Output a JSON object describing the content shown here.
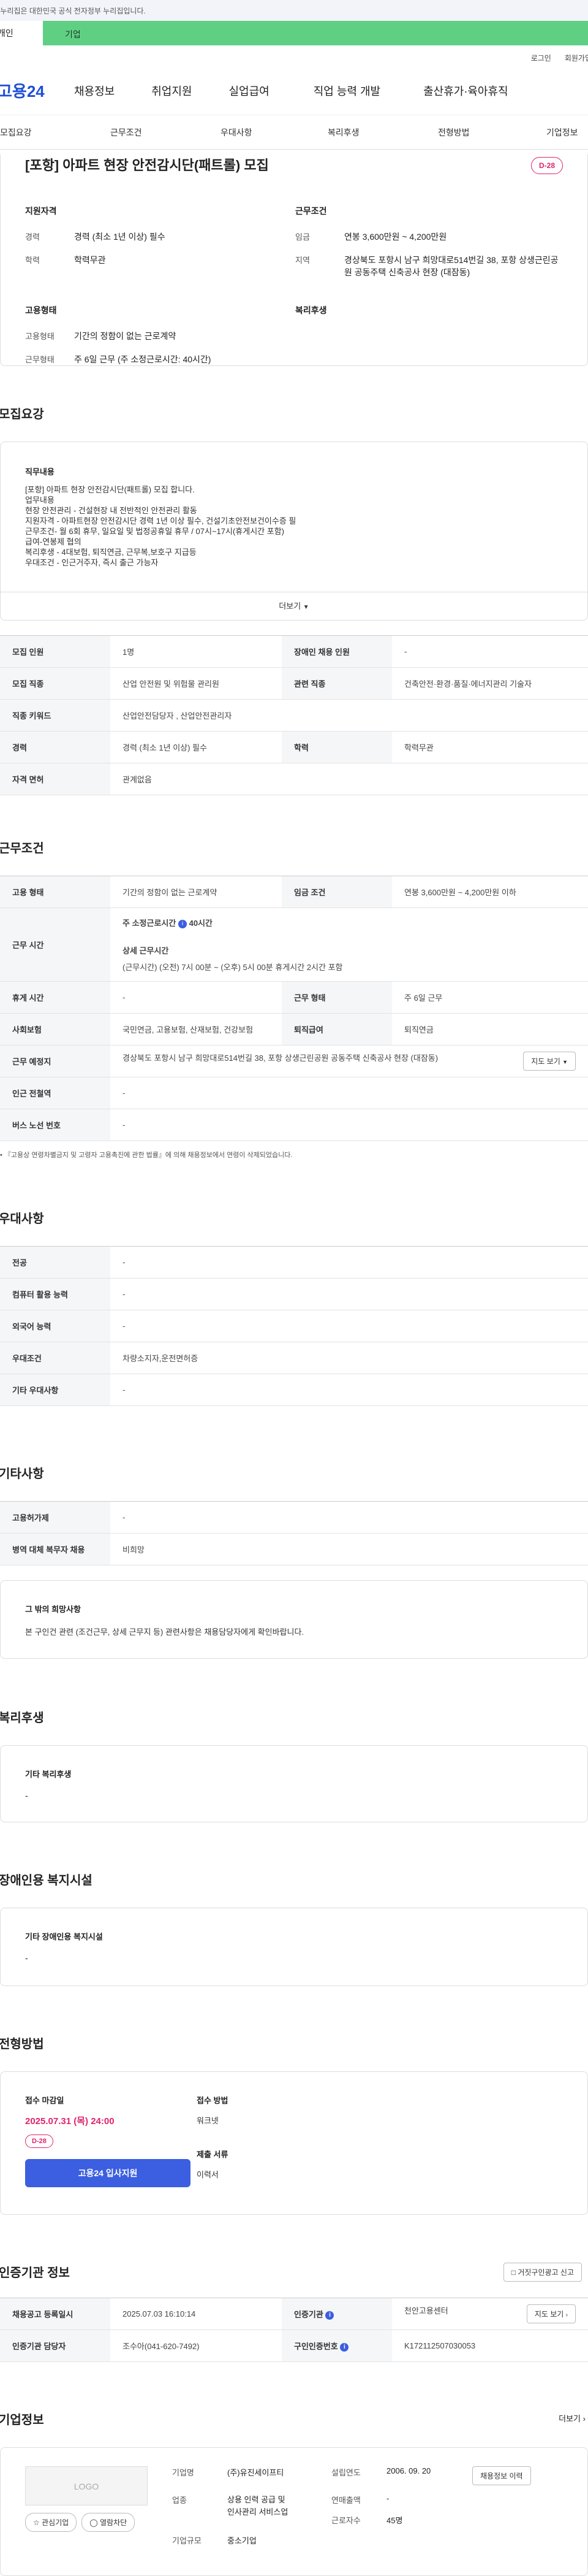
{
  "gov_banner": "이 누리집은 대한민국 공식 전자정부 누리집입니다.",
  "top_tabs": [
    "개인",
    "기업"
  ],
  "util_links": [
    "로그인",
    "회원가입"
  ],
  "logo": "고용24",
  "gnb": [
    "채용정보",
    "취업지원",
    "실업급여",
    "직업 능력 개발",
    "출산휴가·육아휴직"
  ],
  "snb": [
    "모집요강",
    "근무조건",
    "우대사항",
    "복리후생",
    "전형방법",
    "기업정보"
  ],
  "title": "[포항] 아파트 현장 안전감시단(패트롤) 모집",
  "dday": "D-28",
  "summary": {
    "qual_title": "지원자격",
    "career_k": "경력",
    "career_v": "경력 (최소 1년 이상) 필수",
    "edu_k": "학력",
    "edu_v": "학력무관",
    "cond_title": "근무조건",
    "wage_k": "임금",
    "wage_v": "연봉 3,600만원 ~ 4,200만원",
    "region_k": "지역",
    "region_v": "경상북도 포항시 남구 희망대로514번길 38, 포항 상생근린공원 공동주택 신축공사 현장 (대잠동)",
    "emp_title": "고용형태",
    "emp_k": "고용형태",
    "emp_v": "기간의 정함이 없는 근로계약",
    "hours_k": "근무형태",
    "hours_v": "주 6일 근무 (주 소정근로시간: 40시간)",
    "welfare_title": "복리후생"
  },
  "recruit": {
    "section": "모집요강",
    "job_title": "직무내용",
    "job_lines": [
      "[포항] 아파트 현장 안전감시단(패트롤) 모집 합니다.",
      "업무내용",
      "현장 안전관리 - 건설현장 내 전반적인 안전관리 활동",
      "지원자격 - 아파트현장 안전감시단 경력 1년 이상 필수, 건설기초안전보건이수증 필",
      "근무조건- 월 6회 휴무, 일요일 및 법정공휴일 휴무 / 07시~17시(휴게시간 포함)",
      "급여-연봉제 협의",
      "복리후생 - 4대보험, 퇴직연금, 근무복,보호구 지급등",
      "우대조건 - 인근거주자, 즉시 출근 가능자"
    ],
    "more": "더보기",
    "rows": [
      {
        "k1": "모집 인원",
        "v1": "1명",
        "k2": "장애인 채용 인원",
        "v2": "-"
      },
      {
        "k1": "모집 직종",
        "v1": "산업 안전원 및 위험물 관리원",
        "k2": "관련 직종",
        "v2": "건축안전·환경·품질·에너지관리 기술자"
      },
      {
        "k1": "직종 키워드",
        "v1": "산업안전담당자 , 산업안전관리자"
      },
      {
        "k1": "경력",
        "v1": "경력 (최소 1년 이상) 필수",
        "k2": "학력",
        "v2": "학력무관"
      },
      {
        "k1": "자격 면허",
        "v1": "관계없음"
      }
    ]
  },
  "work": {
    "section": "근무조건",
    "emp_k": "고용 형태",
    "emp_v": "기간의 정함이 없는 근로계약",
    "wage_k": "임금 조건",
    "wage_v": "연봉 3,600만원 ~ 4,200만원 이하",
    "time_k": "근무 시간",
    "week_label": "주 소정근로시간",
    "week_v": "40시간",
    "detail_label": "상세 근무시간",
    "detail_v": "(근무시간) (오전) 7시 00분 ~ (오후) 5시 00분 휴게시간 2시간 포함",
    "rest_k": "휴게 시간",
    "rest_v": "-",
    "type_k": "근무 형태",
    "type_v": "주 6일 근무",
    "ins_k": "사회보험",
    "ins_v": "국민연금, 고용보험, 산재보험, 건강보험",
    "ret_k": "퇴직급여",
    "ret_v": "퇴직연금",
    "place_k": "근무 예정지",
    "place_v": "경상북도 포항시 남구 희망대로514번길 38, 포항 상생근린공원 공동주택 신축공사 현장 (대잠동)",
    "map_btn": "지도 보기",
    "subway_k": "인근 전철역",
    "subway_v": "-",
    "bus_k": "버스 노선 번호",
    "bus_v": "-",
    "notice": "『고용상 연령차별금지 및 고령자 고용촉진에 관한 법률』에 의해 채용정보에서 연령이 삭제되었습니다."
  },
  "pref": {
    "section": "우대사항",
    "rows": [
      [
        "전공",
        "-"
      ],
      [
        "컴퓨터 활용 능력",
        "-"
      ],
      [
        "외국어 능력",
        "-"
      ],
      [
        "우대조건",
        "차량소지자,운전면허증"
      ],
      [
        "기타 우대사항",
        "-"
      ]
    ]
  },
  "etc": {
    "section": "기타사항",
    "rows": [
      [
        "고용허가제",
        "-"
      ],
      [
        "병역 대체 복무자 채용",
        "비희망"
      ]
    ],
    "wish_title": "그 밖의 희망사항",
    "wish_v": "본 구인건 관련 (조건근무, 상세 근무지 등) 관련사항은 채용담당자에게 확인바랍니다."
  },
  "welfare": {
    "section": "복리후생",
    "title": "기타 복리후생",
    "v": "-"
  },
  "disabled": {
    "section": "장애인용 복지시설",
    "title": "기타 장애인용 복지시설",
    "v": "-"
  },
  "process": {
    "section": "전형방법",
    "deadline_label": "접수 마감일",
    "deadline_v": "2025.07.31 (목) 24:00",
    "dday": "D-28",
    "apply_btn": "고용24 입사지원",
    "method_label": "접수 방법",
    "method_v": "워크넷",
    "docs_label": "제출 서류",
    "docs_v": "이력서"
  },
  "agency": {
    "section": "인증기관 정보",
    "report_btn": "거짓구인광고 신고",
    "reg_k": "채용공고 등록일시",
    "reg_v": "2025.07.03 16:10:14",
    "org_k": "인증기관",
    "org_v": "천안고용센터",
    "map_btn": "지도 보기",
    "mgr_k": "인증기관 담당자",
    "mgr_v": "조수아(041-620-7492)",
    "no_k": "구인인증번호",
    "no_v": "K172112507030053"
  },
  "company": {
    "section": "기업정보",
    "more": "더보기",
    "logo_text": "LOGO",
    "fav_btn": "관심기업",
    "block_btn": "열람차단",
    "name_k": "기업명",
    "name_v": "(주)유진세이프티",
    "found_k": "설립연도",
    "found_v": "2006. 09. 20",
    "info_btn": "채용정보 이력",
    "biz_k": "업종",
    "biz_v": "상용 인력 공급 및 인사관리 서비스업",
    "sales_k": "연매출액",
    "sales_v": "-",
    "staff_k": "근로자수",
    "staff_v": "45명",
    "size_k": "기업규모",
    "size_v": "중소기업"
  }
}
